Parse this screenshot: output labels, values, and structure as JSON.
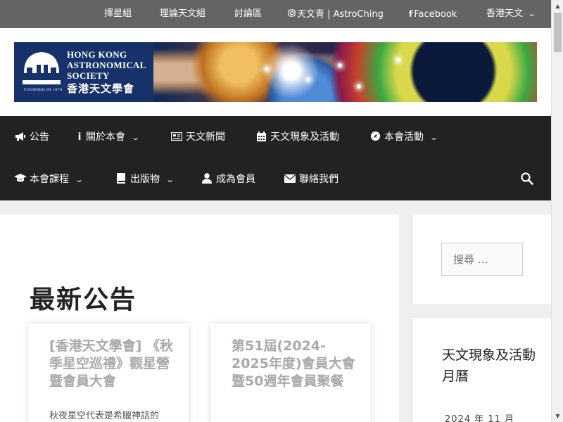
{
  "topbar": {
    "items": [
      {
        "label": "擇星組"
      },
      {
        "label": "理論天文組"
      },
      {
        "label": "討論區"
      },
      {
        "label": "天文青 | AstroChing",
        "icon": "instagram-icon"
      },
      {
        "label": "Facebook",
        "icon": "facebook-icon"
      },
      {
        "label": "香港天文",
        "icon": "chevron-down-icon"
      }
    ]
  },
  "header": {
    "org_en_lines": [
      "Hong Kong",
      "Astronomical",
      "Society"
    ],
    "org_zh": "香港天文學會",
    "founded": "FOUNDED IN 1974"
  },
  "nav": {
    "items": [
      {
        "label": "公告",
        "icon": "megaphone-icon"
      },
      {
        "label": "關於本會",
        "icon": "info-icon",
        "has_dropdown": true
      },
      {
        "label": "天文新聞",
        "icon": "newspaper-icon"
      },
      {
        "label": "天文現象及活動",
        "icon": "calendar-icon"
      },
      {
        "label": "本會活動",
        "icon": "compass-icon",
        "has_dropdown": true
      },
      {
        "label": "本會課程",
        "icon": "graduation-cap-icon",
        "has_dropdown": true
      },
      {
        "label": "出版物",
        "icon": "book-icon",
        "has_dropdown": true
      },
      {
        "label": "成為會員",
        "icon": "user-icon"
      },
      {
        "label": "聯絡我們",
        "icon": "envelope-icon"
      }
    ],
    "search_icon": "search-icon"
  },
  "main": {
    "title": "最新公告",
    "cards": [
      {
        "title": "[香港天文學會] 《秋季星空巡禮》觀星營暨會員大會",
        "excerpt": "秋夜星空代表是希臘神話的"
      },
      {
        "title": "第51屆(2024-2025年度)會員大會暨50週年會員聚餐",
        "excerpt": ""
      }
    ]
  },
  "sidebar": {
    "search_placeholder": "搜尋 …",
    "calendar_title": "天文現象及活動月曆",
    "calendar_month": "2024 年 11 月"
  },
  "colors": {
    "topbar_bg": "#646464",
    "nav_bg": "#222222",
    "card_title": "#a9a9a9",
    "page_bg": "#efefef"
  }
}
